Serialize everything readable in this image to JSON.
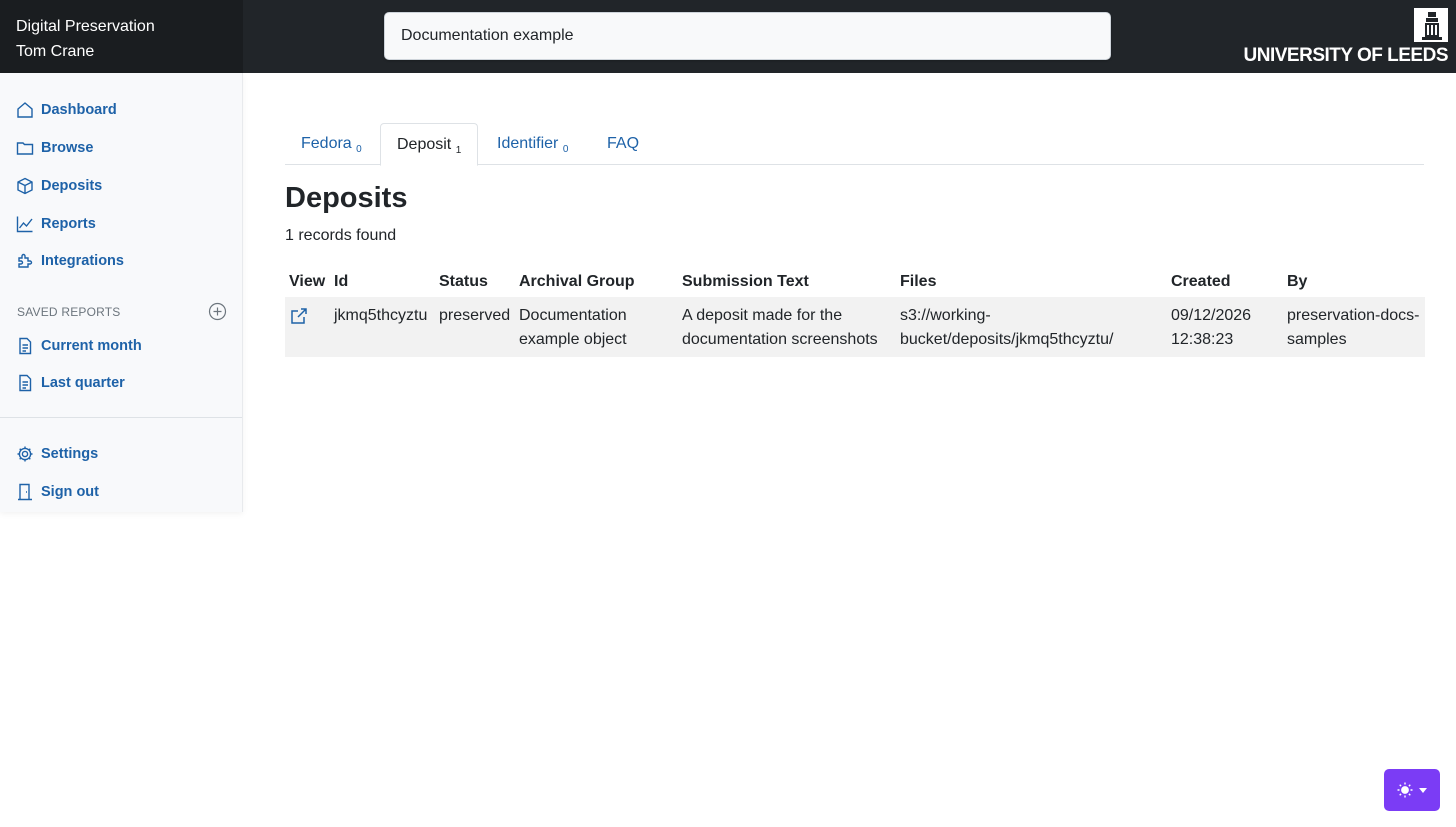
{
  "app": {
    "title": "Digital Preservation",
    "user": "Tom Crane"
  },
  "search": {
    "value": "Documentation example",
    "placeholder": ""
  },
  "university": {
    "name": "UNIVERSITY OF LEEDS"
  },
  "sidebar": {
    "items": [
      {
        "label": "Dashboard",
        "icon": "home-icon"
      },
      {
        "label": "Browse",
        "icon": "folder-icon"
      },
      {
        "label": "Deposits",
        "icon": "box-icon"
      },
      {
        "label": "Reports",
        "icon": "chart-line-icon"
      },
      {
        "label": "Integrations",
        "icon": "plugin-icon"
      }
    ],
    "saved_reports_header": "SAVED REPORTS",
    "saved_reports": [
      {
        "label": "Current month",
        "icon": "document-icon"
      },
      {
        "label": "Last quarter",
        "icon": "document-icon"
      }
    ],
    "bottom": [
      {
        "label": "Settings",
        "icon": "gear-icon"
      },
      {
        "label": "Sign out",
        "icon": "door-icon"
      }
    ]
  },
  "tabs": [
    {
      "label": "Fedora",
      "count": "0",
      "active": false
    },
    {
      "label": "Deposit",
      "count": "1",
      "active": true
    },
    {
      "label": "Identifier",
      "count": "0",
      "active": false
    },
    {
      "label": "FAQ",
      "count": "",
      "active": false
    }
  ],
  "main": {
    "title": "Deposits",
    "record_count": "1 records found"
  },
  "table": {
    "headers": [
      "View",
      "Id",
      "Status",
      "Archival Group",
      "Submission Text",
      "Files",
      "Created",
      "By"
    ],
    "rows": [
      {
        "id": "jkmq5thcyztu",
        "status": "preserved",
        "archival_group": "Documentation example object",
        "submission_text": "A deposit made for the documentation screenshots",
        "files": "s3://working-bucket/deposits/jkmq5thcyztu/",
        "created": "09/12/2026 12:38:23",
        "by": "preservation-docs-samples"
      }
    ]
  },
  "colors": {
    "link": "#1e62a8",
    "topbar": "#212529",
    "theme_button": "#7b3cf5"
  }
}
